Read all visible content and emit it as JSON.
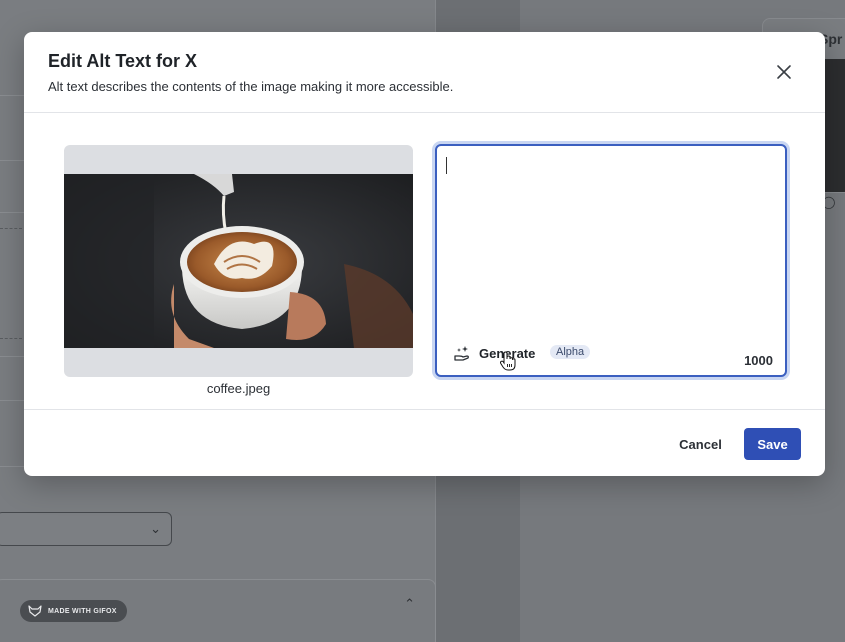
{
  "background": {
    "card_title": "Spr"
  },
  "modal": {
    "title": "Edit Alt Text for X",
    "subtitle": "Alt text describes the contents of the image making it more accessible.",
    "image": {
      "filename": "coffee.jpeg"
    },
    "alt_text": {
      "value": "",
      "placeholder": "",
      "generate_label": "Generate",
      "badge": "Alpha",
      "char_remaining": "1000"
    },
    "footer": {
      "cancel_label": "Cancel",
      "save_label": "Save"
    }
  },
  "watermark": {
    "label": "MADE WITH GIFOX"
  },
  "colors": {
    "accent": "#2f4fb5",
    "focus_ring": "#3b5fc0",
    "overlay": "#6f7276"
  }
}
